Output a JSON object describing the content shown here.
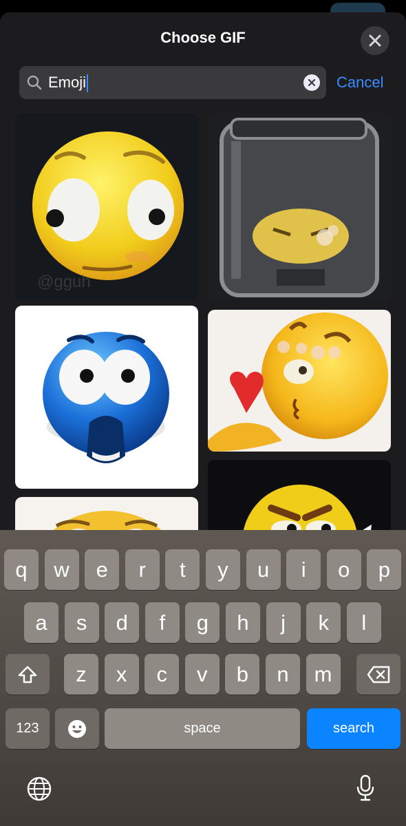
{
  "sheet": {
    "title": "Choose GIF",
    "close_icon": "close-icon"
  },
  "search": {
    "value": "Emoji",
    "search_icon": "magnifier-icon",
    "clear_icon": "clear-x-icon",
    "cancel_label": "Cancel"
  },
  "gifs": [
    {
      "subject": "wide-eyed-yellow-emoji",
      "watermark": "@gguh"
    },
    {
      "subject": "emoji-in-jar"
    },
    {
      "subject": "shocked-blue-emoji"
    },
    {
      "subject": "kissing-emoji-with-heart"
    },
    {
      "subject": "worried-emoji-partial"
    },
    {
      "subject": "angry-emoji-partial"
    }
  ],
  "keyboard": {
    "row1": [
      "q",
      "w",
      "e",
      "r",
      "t",
      "y",
      "u",
      "i",
      "o",
      "p"
    ],
    "row2": [
      "a",
      "s",
      "d",
      "f",
      "g",
      "h",
      "j",
      "k",
      "l"
    ],
    "row3": [
      "z",
      "x",
      "c",
      "v",
      "b",
      "n",
      "m"
    ],
    "numbers_label": "123",
    "space_label": "space",
    "search_label": "search",
    "shift_icon": "shift-icon",
    "delete_icon": "delete-icon",
    "emoji_icon": "emoji-icon",
    "globe_icon": "globe-icon",
    "mic_icon": "microphone-icon"
  },
  "colors": {
    "accent": "#0a84ff",
    "sheet_bg": "#1c1c1e",
    "field_bg": "#3a3a3c"
  }
}
